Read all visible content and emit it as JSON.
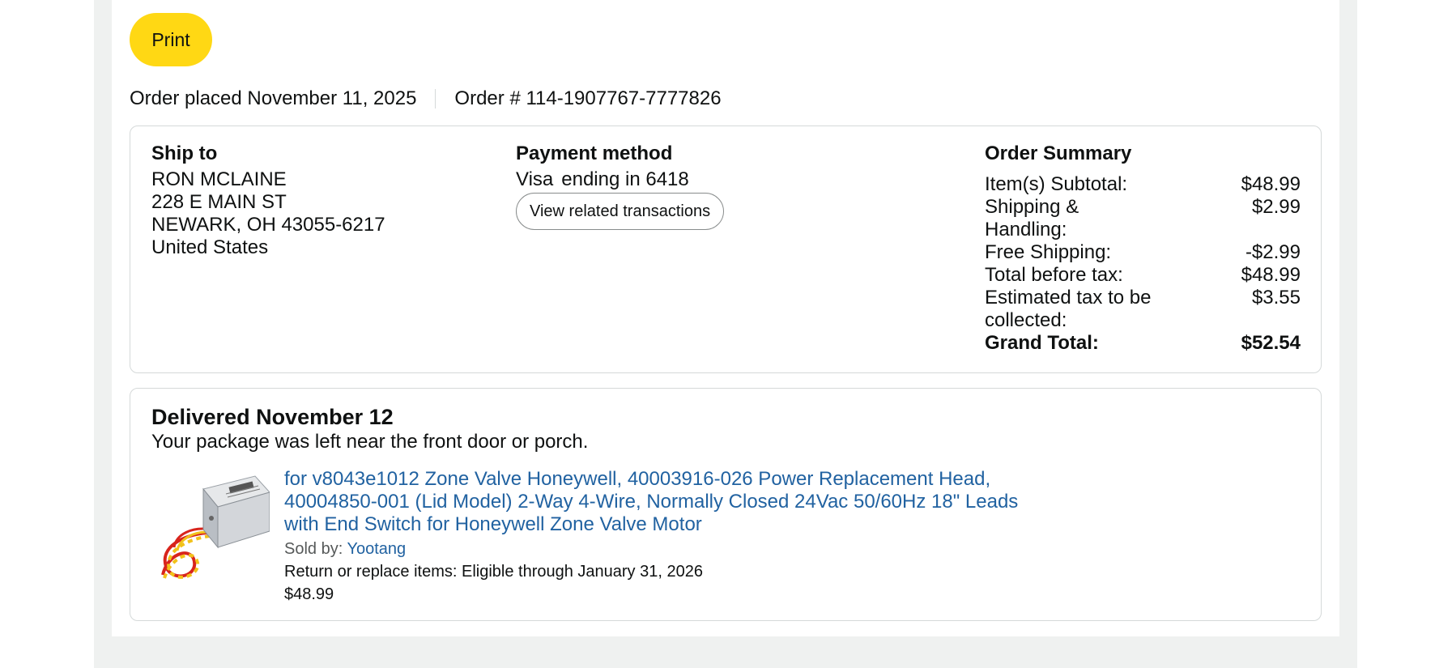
{
  "toolbar": {
    "print_label": "Print"
  },
  "order": {
    "placed": "Order placed November 11, 2025",
    "number": "Order # 114-1907767-7777826"
  },
  "ship_to": {
    "heading": "Ship to",
    "lines": [
      "RON MCLAINE",
      "228 E MAIN ST",
      "NEWARK, OH 43055-6217",
      "United States"
    ]
  },
  "payment": {
    "heading": "Payment method",
    "card_brand": "Visa",
    "card_ending": "ending in 6418",
    "view_button": "View related transactions"
  },
  "summary": {
    "heading": "Order Summary",
    "rows": [
      {
        "label": "Item(s) Subtotal:",
        "value": "$48.99"
      },
      {
        "label": "Shipping & Handling:",
        "value": "$2.99"
      },
      {
        "label": "Free Shipping:",
        "value": "-$2.99"
      },
      {
        "label": "Total before tax:",
        "value": "$48.99"
      },
      {
        "label": "Estimated tax to be collected:",
        "value": "$3.55"
      }
    ],
    "grand": {
      "label": "Grand Total:",
      "value": "$52.54"
    }
  },
  "delivery": {
    "title": "Delivered November 12",
    "subtitle": "Your package was left near the front door or porch."
  },
  "item": {
    "title": "for v8043e1012 Zone Valve Honeywell, 40003916-026 Power Replacement Head, 40004850-001 (Lid Model) 2-Way 4-Wire, Normally Closed 24Vac 50/60Hz 18\" Leads with End Switch for Honeywell Zone Valve Motor",
    "sold_by_label": "Sold by:",
    "seller": "Yootang",
    "return_text": "Return or replace items: Eligible through January 31, 2026",
    "price": "$48.99"
  },
  "colors": {
    "print_button": "#ffd814",
    "link": "#2162a1",
    "page_bg": "#eff1f0",
    "border": "#d5d9d9"
  }
}
